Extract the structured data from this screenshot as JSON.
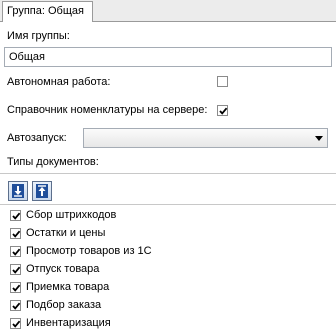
{
  "tab": {
    "label": "Группа: Общая"
  },
  "group_name": {
    "label": "Имя группы:",
    "value": "Общая"
  },
  "autonomous": {
    "label": "Автономная работа:",
    "checked": false
  },
  "catalog_on_server": {
    "label": "Справочник номенклатуры на сервере:",
    "checked": true
  },
  "autostart": {
    "label": "Автозапуск:",
    "value": ""
  },
  "doc_types": {
    "label": "Типы документов:",
    "items": [
      {
        "label": "Сбор штрихкодов",
        "checked": true
      },
      {
        "label": "Остатки и цены",
        "checked": true
      },
      {
        "label": "Просмотр товаров из 1С",
        "checked": true
      },
      {
        "label": "Отпуск товара",
        "checked": true
      },
      {
        "label": "Приемка товара",
        "checked": true
      },
      {
        "label": "Подбор заказа",
        "checked": true
      },
      {
        "label": "Инвентаризация",
        "checked": true
      }
    ]
  },
  "toolbar": {
    "move_down_icon": "move-down-icon",
    "move_up_icon": "move-up-icon"
  }
}
